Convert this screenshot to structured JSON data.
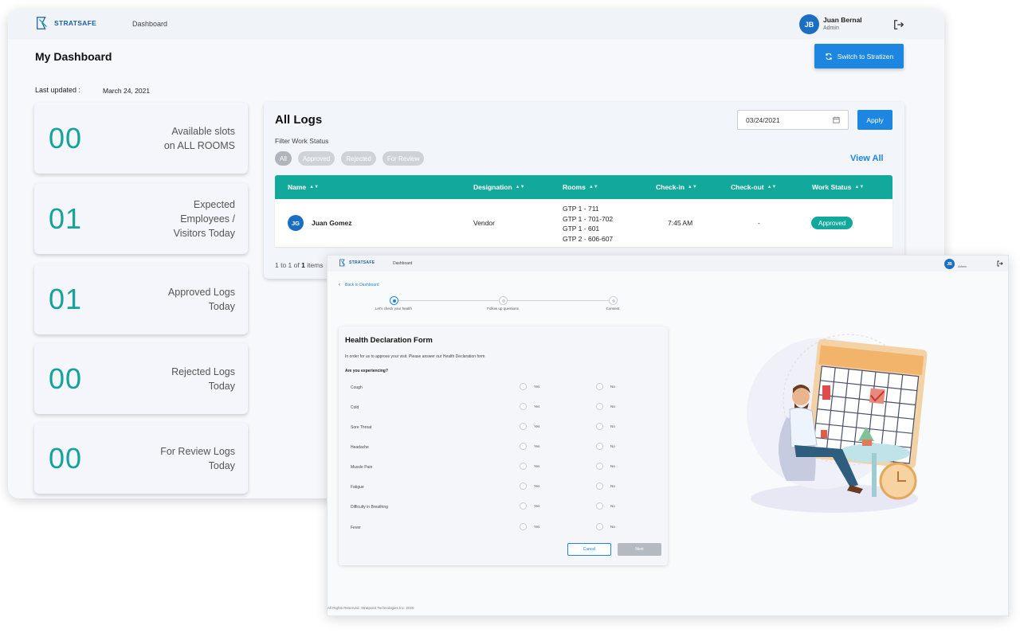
{
  "dashboard": {
    "brand": "STRATSAFE",
    "nav_label": "Dashboard",
    "user": {
      "initials": "JB",
      "name": "Juan Bernal",
      "role": "Admin"
    },
    "title": "My Dashboard",
    "switch_button": "Switch to Stratizen",
    "last_updated_label": "Last updated :",
    "last_updated_value": "March 24, 2021",
    "stats": [
      {
        "value": "00",
        "label": "Available slots\non ALL ROOMS"
      },
      {
        "value": "01",
        "label": "Expected\nEmployees /\nVisitors Today"
      },
      {
        "value": "01",
        "label": "Approved Logs\nToday"
      },
      {
        "value": "00",
        "label": "Rejected Logs\nToday"
      },
      {
        "value": "00",
        "label": "For Review Logs\nToday"
      }
    ],
    "logs": {
      "title": "All Logs",
      "filter_label": "Filter Work Status",
      "filters": [
        "All",
        "Approved",
        "Rejected",
        "For Review"
      ],
      "date_value": "03/24/2021",
      "apply_label": "Apply",
      "view_all": "View All",
      "columns": [
        "Name",
        "Designation",
        "Rooms",
        "Check-in",
        "Check-out",
        "Work Status"
      ],
      "rows": [
        {
          "initials": "JG",
          "name": "Juan Gomez",
          "designation": "Vendor",
          "rooms": "GTP 1 - 711\nGTP 1 - 701-702\nGTP 1 - 601\nGTP 2 - 606-607",
          "checkin": "7:45 AM",
          "checkout": "-",
          "status": "Approved"
        }
      ],
      "pager_prefix": "1 to 1 of ",
      "pager_total": "1",
      "pager_suffix": " items"
    }
  },
  "health_form": {
    "brand": "STRATSAFE",
    "nav_label": "Dashboard",
    "user": {
      "initials": "JB",
      "role": "Admin"
    },
    "back_label": "Back to Dashboard",
    "steps": [
      "Let's check your health",
      "Follow up questions",
      "Consent"
    ],
    "title": "Health Declaration Form",
    "intro": "In order for us to approve your visit. Please answer our Health Declaration form",
    "question": "Are you experiencing?",
    "yes_label": "Yes",
    "no_label": "No",
    "symptoms": [
      "Cough",
      "Cold",
      "Sore Throat",
      "Headache",
      "Muscle Pain",
      "Fatigue",
      "Difficulty in Breathing",
      "Fever"
    ],
    "cancel_label": "Cancel",
    "next_label": "Next",
    "footer": "All Rights Reserved. Stratpoint Technologies Inc. 2020"
  },
  "colors": {
    "accent": "#1d86e0",
    "teal": "#12a89c",
    "stat_number": "#14a39a"
  }
}
